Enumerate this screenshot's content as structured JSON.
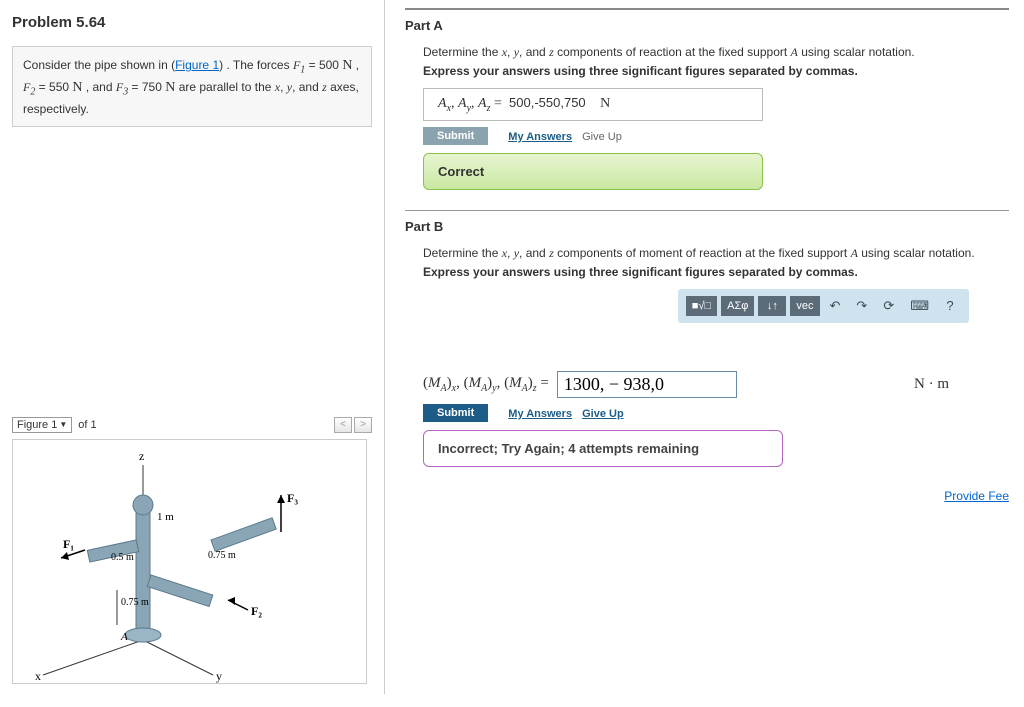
{
  "problem": {
    "title": "Problem 5.64",
    "statement_pre": "Consider the pipe shown in (",
    "figure_link": "Figure 1",
    "statement_post": ") . The forces ",
    "forces": "F₁ = 500 N , F₂ = 550 N , and F₃ = 750 N are parallel to the x, y, and z axes, respectively."
  },
  "figure": {
    "selected": "Figure 1",
    "count_label": "of 1",
    "labels": {
      "z": "z",
      "y": "y",
      "x": "x",
      "F1": "F₁",
      "F2": "F₂",
      "F3": "F₃",
      "A": "A",
      "d1": "1 m",
      "d2": "0.5 m",
      "d3": "0.75 m",
      "d4": "0.75 m"
    }
  },
  "partA": {
    "title": "Part A",
    "instr": "Determine the x, y, and z components of reaction at the fixed support A using scalar notation.",
    "instr_bold": "Express your answers using three significant figures separated by commas.",
    "label": "Aₓ, Aᵧ, A_z = ",
    "value": "500,-550,750",
    "unit": "N",
    "submit": "Submit",
    "my_answers": "My Answers",
    "give_up": "Give Up",
    "feedback": "Correct"
  },
  "partB": {
    "title": "Part B",
    "instr": "Determine the x, y, and z components of moment of reaction at the fixed support A using scalar notation.",
    "instr_bold": "Express your answers using three significant figures separated by commas.",
    "toolbar": {
      "t1": "■√□",
      "t2": "ΑΣφ",
      "t3": "↓↑",
      "t4": "vec",
      "undo": "↶",
      "redo": "↷",
      "reset": "⟳",
      "kbd": "⌨",
      "help": "?"
    },
    "label": "(M_A)ₓ, (M_A)ᵧ, (M_A)_z = ",
    "value": "1300, − 938,0",
    "unit": "N · m",
    "submit": "Submit",
    "my_answers": "My Answers",
    "give_up": "Give Up",
    "feedback": "Incorrect; Try Again; 4 attempts remaining"
  },
  "provide": "Provide Fee"
}
